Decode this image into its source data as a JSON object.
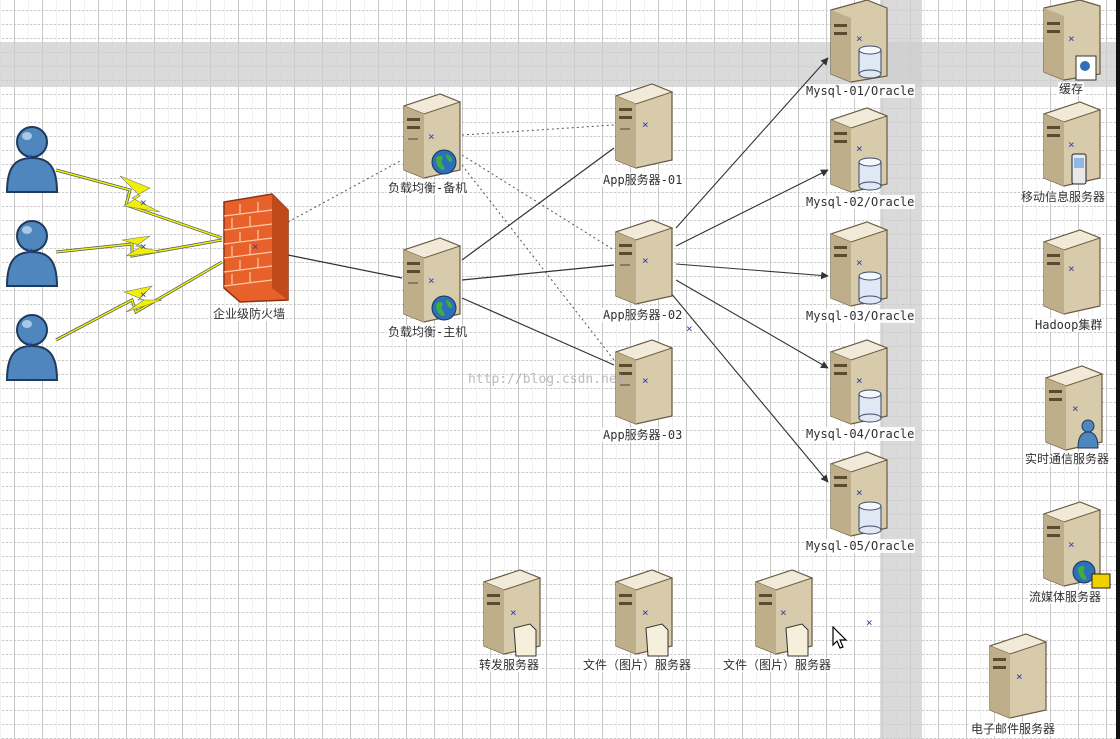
{
  "colors": {
    "server_light": "#f2ead8",
    "server_mid": "#d8cbac",
    "server_dark": "#9d8a68",
    "user_blue": "#4f86bd",
    "firewall_orange": "#e8602a",
    "lightning_yellow": "#f1f000",
    "connector": "#333333",
    "cross_marker": "#3040d0"
  },
  "labels": {
    "firewall": "企业级防火墙",
    "lb_backup": "负载均衡-备机",
    "lb_main": "负载均衡-主机",
    "app1": "App服务器-01",
    "app2": "App服务器-02",
    "app3": "App服务器-03",
    "mysql1": "Mysql-01/Oracle",
    "mysql2": "Mysql-02/Oracle",
    "mysql3": "Mysql-03/Oracle",
    "mysql4": "Mysql-04/Oracle",
    "mysql5": "Mysql-05/Oracle",
    "cache": "缓存",
    "mobile": "移动信息服务器",
    "hadoop": "Hadoop集群",
    "im": "实时通信服务器",
    "stream": "流媒体服务器",
    "mail": "电子邮件服务器",
    "forward": "转发服务器",
    "file1": "文件（图片）服务器",
    "file2": "文件（图片）服务器"
  },
  "watermark": "http://blog.csdn.net",
  "icons": {
    "user": "user-icon",
    "firewall": "brick-firewall-icon",
    "server": "tower-server-icon",
    "database": "database-cylinder-icon",
    "globe": "globe-icon",
    "phone": "mobile-phone-icon",
    "document": "document-icon",
    "lightning": "lightning-link-icon"
  }
}
